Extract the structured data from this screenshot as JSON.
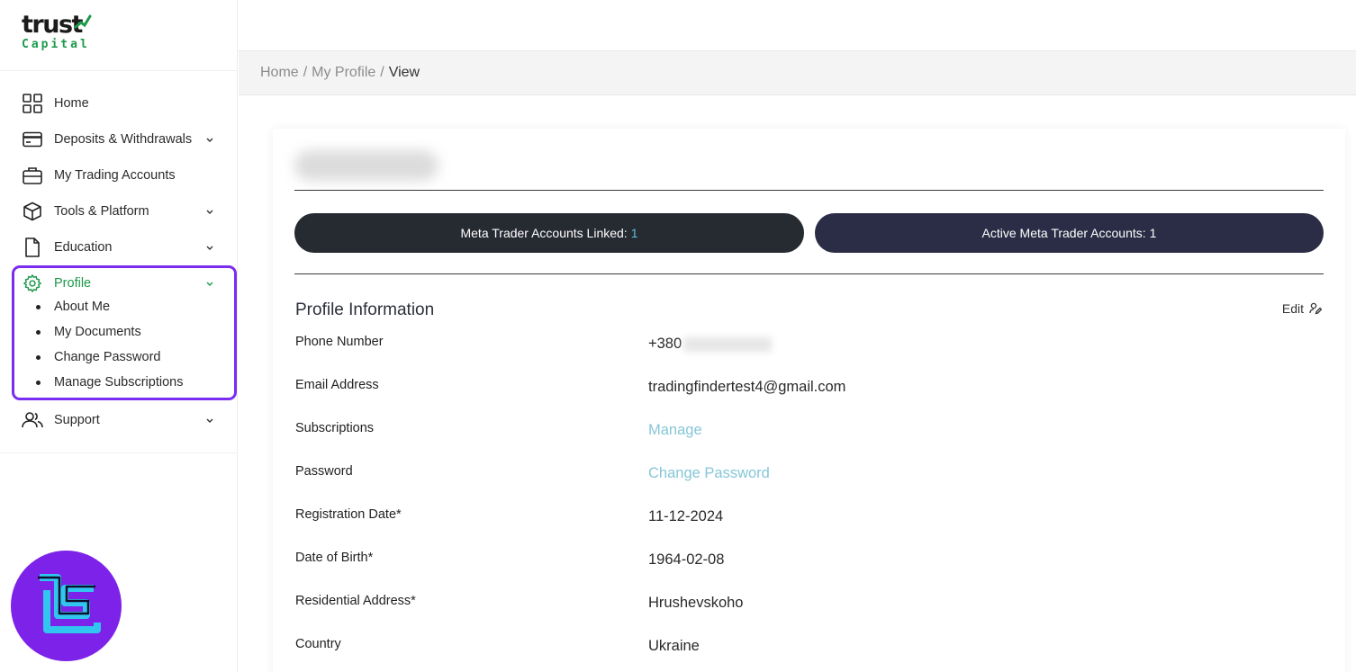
{
  "brand": {
    "logo_text": "trust",
    "logo_sub": "Capital",
    "accent": "#1c9a4a",
    "highlight": "#7a2df0"
  },
  "sidebar": {
    "items": [
      {
        "label": "Home",
        "icon": "grid-icon"
      },
      {
        "label": "Deposits & Withdrawals",
        "icon": "card-icon"
      },
      {
        "label": "My Trading Accounts",
        "icon": "briefcase-icon"
      },
      {
        "label": "Tools & Platform",
        "icon": "cube-icon"
      },
      {
        "label": "Education",
        "icon": "document-icon"
      },
      {
        "label": "Profile",
        "icon": "gear-icon"
      },
      {
        "label": "Support",
        "icon": "users-icon"
      }
    ],
    "profile_sub": [
      "About Me",
      "My Documents",
      "Change Password",
      "Manage Subscriptions"
    ]
  },
  "breadcrumb": {
    "home": "Home",
    "section": "My Profile",
    "current": "View",
    "sep": "/"
  },
  "stats": {
    "linked_label": "Meta Trader Accounts Linked:",
    "linked_value": "1",
    "active_label": "Active Meta Trader Accounts:",
    "active_value": "1"
  },
  "profile": {
    "title": "Profile Information",
    "edit_label": "Edit",
    "rows": [
      {
        "label": "Phone Number",
        "value": "+380"
      },
      {
        "label": "Email Address",
        "value": "tradingfindertest4@gmail.com"
      },
      {
        "label": "Subscriptions",
        "value": "Manage"
      },
      {
        "label": "Password",
        "value": "Change Password"
      },
      {
        "label": "Registration Date*",
        "value": "11-12-2024"
      },
      {
        "label": "Date of Birth*",
        "value": "1964-02-08"
      },
      {
        "label": "Residential Address*",
        "value": "Hrushevskoho"
      },
      {
        "label": "Country",
        "value": "Ukraine"
      }
    ]
  }
}
